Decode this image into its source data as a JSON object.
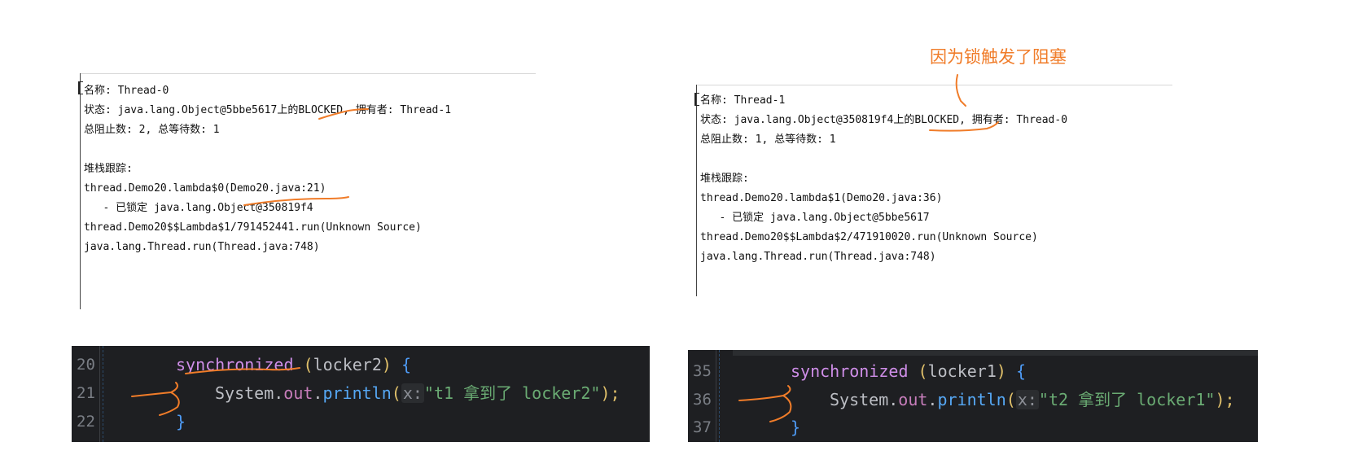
{
  "left_thread_info": {
    "lines": [
      "名称: Thread-0",
      "状态: java.lang.Object@5bbe5617上的BLOCKED, 拥有者: Thread-1",
      "总阻止数: 2, 总等待数: 1",
      "",
      "堆栈跟踪:",
      "thread.Demo20.lambda$0(Demo20.java:21)",
      "   - 已锁定 java.lang.Object@350819f4",
      "thread.Demo20$$Lambda$1/791452441.run(Unknown Source)",
      "java.lang.Thread.run(Thread.java:748)"
    ]
  },
  "right_thread_info": {
    "lines": [
      "名称: Thread-1",
      "状态: java.lang.Object@350819f4上的BLOCKED, 拥有者: Thread-0",
      "总阻止数: 1, 总等待数: 1",
      "",
      "堆栈跟踪:",
      "thread.Demo20.lambda$1(Demo20.java:36)",
      "   - 已锁定 java.lang.Object@5bbe5617",
      "thread.Demo20$$Lambda$2/471910020.run(Unknown Source)",
      "java.lang.Thread.run(Thread.java:748)"
    ]
  },
  "annotation": {
    "text": "因为锁触发了阻塞",
    "color": "#f07c29"
  },
  "left_code": {
    "line_numbers": [
      "20",
      "21",
      "22"
    ],
    "line1": {
      "keyword": "synchronized",
      "open": "(",
      "arg": "locker2",
      "close": ")",
      "brace": "{"
    },
    "line2": {
      "class": "System",
      "dot1": ".",
      "field": "out",
      "dot2": ".",
      "method": "println",
      "open": "(",
      "hint": "x:",
      "string": "\"t1 拿到了 locker2\"",
      "close": ");"
    },
    "line3": {
      "brace": "}"
    }
  },
  "right_code": {
    "line_numbers": [
      "35",
      "36",
      "37"
    ],
    "line1": {
      "keyword": "synchronized",
      "open": "(",
      "arg": "locker1",
      "close": ")",
      "brace": "{"
    },
    "line2": {
      "class": "System",
      "dot1": ".",
      "field": "out",
      "dot2": ".",
      "method": "println",
      "open": "(",
      "hint": "x:",
      "string": "\"t2 拿到了 locker1\"",
      "close": ");"
    },
    "line3": {
      "brace": "}"
    }
  },
  "colors": {
    "editor_bg": "#1e1f22",
    "keyword": "#cf8ee8",
    "method": "#56a8f5",
    "string": "#6aab73",
    "annotation": "#f07c29"
  }
}
